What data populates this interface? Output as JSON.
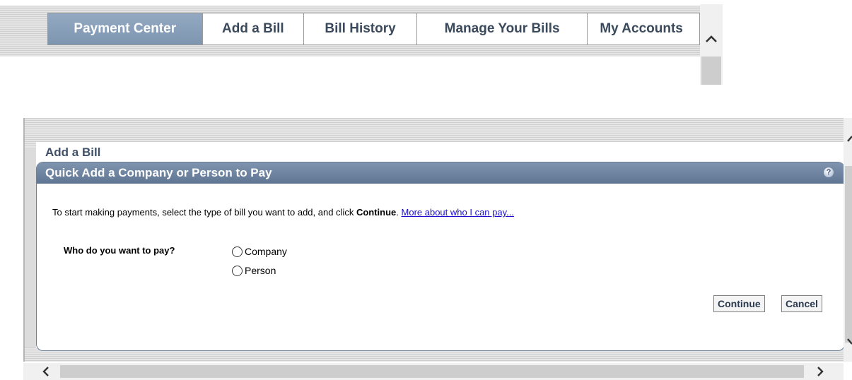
{
  "nav": {
    "tabs": [
      {
        "label": "Payment Center",
        "active": true
      },
      {
        "label": "Add a Bill",
        "active": false
      },
      {
        "label": "Bill History",
        "active": false
      },
      {
        "label": "Manage Your Bills",
        "active": false
      },
      {
        "label": "My Accounts",
        "active": false
      }
    ]
  },
  "section": {
    "title": "Add a Bill"
  },
  "panel": {
    "title": "Quick Add a Company or Person to Pay",
    "help_icon": "?",
    "intro": {
      "text_before": "To start making payments, select the type of bill you want to add, and click ",
      "bold_word": "Continue",
      "text_after": ". ",
      "link_text": "More about who I can pay..."
    },
    "question": "Who do you want to pay?",
    "options": [
      {
        "label": "Company",
        "selected": false
      },
      {
        "label": "Person",
        "selected": false
      }
    ],
    "buttons": {
      "continue": "Continue",
      "cancel": "Cancel"
    }
  },
  "colors": {
    "active_tab": "#8aa0ba",
    "tab_text": "#3a4a5c",
    "panel_header": "#6c829e",
    "link": "#1a0dcc"
  },
  "icons": {
    "help": "help-icon",
    "scroll_up": "chevron-up-icon",
    "scroll_down": "chevron-down-icon",
    "scroll_left": "chevron-left-icon",
    "scroll_right": "chevron-right-icon"
  }
}
